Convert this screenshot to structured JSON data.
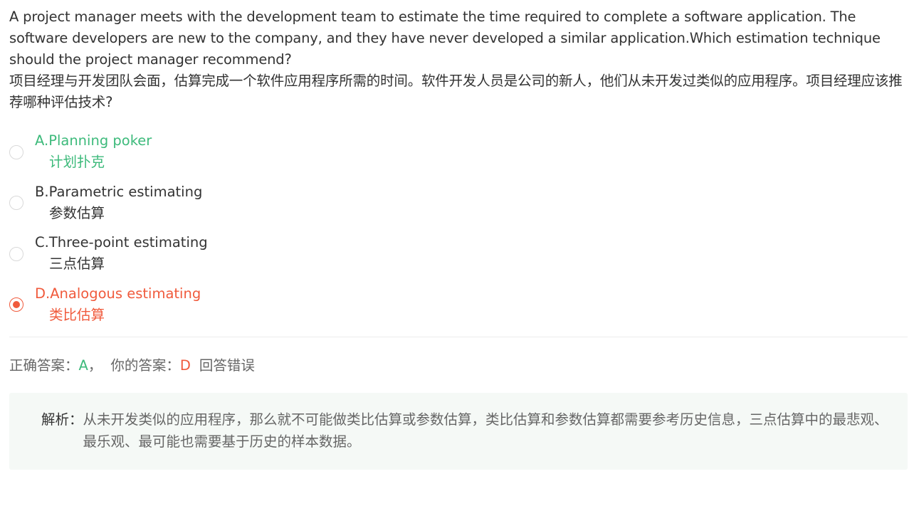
{
  "question": {
    "en": "A project manager meets with the development team to estimate the time required to complete a software application. The software developers are new to the company, and they have never developed a similar application.Which estimation technique should the project manager recommend?",
    "zh": "项目经理与开发团队会面，估算完成一个软件应用程序所需的时间。软件开发人员是公司的新人，他们从未开发过类似的应用程序。项目经理应该推荐哪种评估技术?"
  },
  "options": [
    {
      "en": "A.Planning poker",
      "zh": "计划扑克",
      "state": "correct",
      "selected": false
    },
    {
      "en": "B.Parametric estimating",
      "zh": "参数估算",
      "state": "neutral",
      "selected": false
    },
    {
      "en": "C.Three-point estimating",
      "zh": "三点估算",
      "state": "neutral",
      "selected": false
    },
    {
      "en": "D.Analogous estimating",
      "zh": "类比估算",
      "state": "wrong",
      "selected": true
    }
  ],
  "answer": {
    "correct_label": "正确答案：",
    "correct_value": "A",
    "separator": "，",
    "yours_label": "你的答案：",
    "yours_value": "D",
    "result": "回答错误"
  },
  "analysis": {
    "label": "解析：",
    "text": "从未开发类似的应用程序，那么就不可能做类比估算或参数估算，类比估算和参数估算都需要参考历史信息，三点估算中的最悲观、最乐观、最可能也需要基于历史的样本数据。"
  },
  "colors": {
    "correct": "#3dba7b",
    "wrong": "#f05a3c",
    "text": "#333333",
    "muted": "#666666",
    "analysis_bg": "#f5f9f6"
  }
}
